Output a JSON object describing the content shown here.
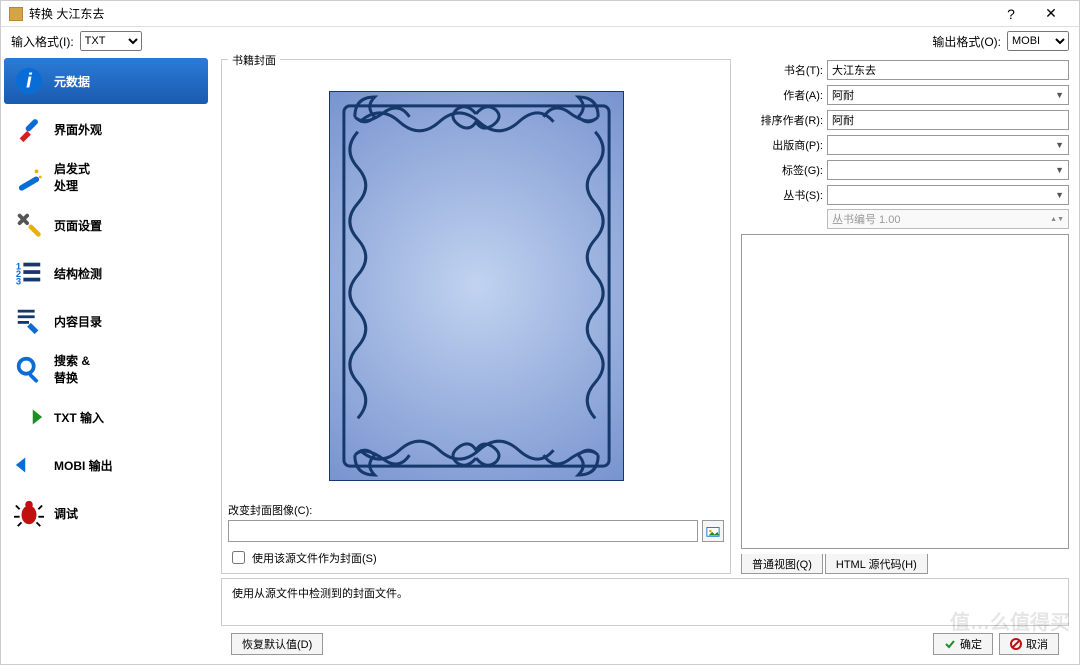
{
  "titlebar": {
    "title": "转换 大江东去"
  },
  "formatbar": {
    "input_label": "输入格式(I):",
    "input_value": "TXT",
    "output_label": "输出格式(O):",
    "output_value": "MOBI"
  },
  "sidebar": {
    "items": [
      {
        "label": "元数据"
      },
      {
        "label": "界面外观"
      },
      {
        "label": "启发式\n处理"
      },
      {
        "label": "页面设置"
      },
      {
        "label": "结构检测"
      },
      {
        "label": "内容目录"
      },
      {
        "label": "搜索 &\n替换"
      },
      {
        "label": "TXT 输入"
      },
      {
        "label": "MOBI 输出"
      },
      {
        "label": "调试"
      }
    ]
  },
  "cover": {
    "legend": "书籍封面",
    "change_label": "改变封面图像(C):",
    "use_source_label": " 使用该源文件作为封面(S)"
  },
  "meta": {
    "title_label": "书名(T):",
    "title_value": "大江东去",
    "author_label": "作者(A):",
    "author_value": "阿耐",
    "sort_label": "排序作者(R):",
    "sort_value": "阿耐",
    "publisher_label": "出版商(P):",
    "publisher_value": "",
    "tags_label": "标签(G):",
    "tags_value": "",
    "series_label": "丛书(S):",
    "series_value": "",
    "series_num_placeholder": "丛书编号 1.00"
  },
  "comments_tabs": {
    "normal": "普通视图(Q)",
    "html": "HTML 源代码(H)"
  },
  "info": {
    "text": "使用从源文件中检测到的封面文件。"
  },
  "footer": {
    "restore": "恢复默认值(D)",
    "ok": "确定",
    "cancel": "取消"
  }
}
